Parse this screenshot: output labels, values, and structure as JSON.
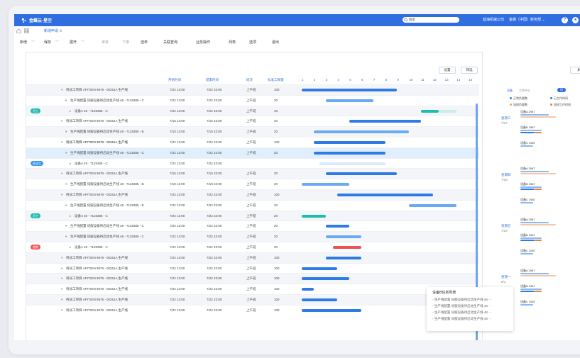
{
  "app": {
    "name": "金蝶云·星空",
    "search_placeholder": "搜索",
    "company": "蓝海机械公司",
    "org": "金蝶（中国）财务部",
    "help": "?"
  },
  "tabs": {
    "home_icon": "home-icon",
    "grid_icon": "grid-icon",
    "active_tab": "新增申请"
  },
  "menu": [
    {
      "label": "新增",
      "caret": true
    },
    {
      "label": "保存",
      "caret": true
    },
    {
      "label": "展开",
      "caret": true
    },
    {
      "label": "审核",
      "dim": true
    },
    {
      "label": "下推",
      "dim": true
    },
    {
      "label": "选单"
    },
    {
      "label": "关联查询"
    },
    {
      "label": "业务操作"
    },
    {
      "label": "列表"
    },
    {
      "label": "选项"
    },
    {
      "label": "退出"
    }
  ],
  "toolbar": {
    "settings": "设置",
    "filter": "筛选",
    "refresh": "刷新"
  },
  "columns": {
    "start": "开始时间",
    "end": "结束时间",
    "shift": "班次",
    "std_hours": "标准工数量",
    "days": [
      "1",
      "2",
      "3",
      "4",
      "5",
      "6",
      "7",
      "8",
      "9",
      "10",
      "11",
      "12",
      "13",
      "14",
      "15"
    ]
  },
  "rows": [
    {
      "indent": 1,
      "name": "待派工项目 APITION 9878 - 00251A 生产线",
      "start": "7/22 13:00",
      "end": "7/22 23:00",
      "shift": "上午班",
      "qty": "100",
      "bar": [
        0,
        8
      ],
      "color": "#2f7be6",
      "style": "alt"
    },
    {
      "indent": 2,
      "name": "生产线配置 伺服设备待启动生产线 48 - 7128385 - C",
      "start": "7/22 13:00",
      "end": "7/22 23:00",
      "shift": "上午班",
      "qty": "20",
      "bar": [
        2,
        6
      ],
      "color": "#6aaaf3"
    },
    {
      "indent": 3,
      "name": "设备A 48 - 7128385 - C",
      "start": "7/22 13:00",
      "end": "7/22 23:00",
      "shift": "上午班",
      "qty": "40",
      "bar": [
        10,
        11.5
      ],
      "color": "#1fbcb0",
      "badge": "员工",
      "badgeColor": "#1fbcb0",
      "style": "alt"
    },
    {
      "indent": 1,
      "name": "待派工项目 APITION 9878 - 00251A 生产线",
      "start": "7/16 13:00",
      "end": "7/16 23:00",
      "shift": "上午班",
      "qty": "20",
      "bar": [
        4,
        10
      ],
      "color": "#2f7be6"
    },
    {
      "indent": 2,
      "name": "生产线配置 伺服设备待启动生产线 48 - 7128385 - B",
      "start": "7/10 13:00",
      "end": "7/10 23:00",
      "shift": "上午班",
      "qty": "20",
      "bar": [
        1,
        9
      ],
      "color": "#6aaaf3",
      "style": "alt"
    },
    {
      "indent": 1,
      "name": "待派工项目 APITION 9878 - 00251A 生产线",
      "start": "7/22 13:00",
      "end": "7/22 23:00",
      "shift": "上午班",
      "qty": "100",
      "bar": [
        1,
        7
      ],
      "color": "#2f7be6",
      "bold": true
    },
    {
      "indent": 2,
      "name": "生产线配置 伺服设备待启动生产线 48 - 7128385 - C",
      "start": "7/22 13:00",
      "end": "7/22 23:00",
      "shift": "上午班",
      "qty": "20",
      "bar": [
        1,
        7
      ],
      "color": "#2f7be6",
      "style": "sel"
    },
    {
      "indent": 3,
      "name": "设备A 48 - 7128385 - C",
      "start": "7/22 13:00",
      "end": "7/22 23:00",
      "shift": "",
      "qty": "",
      "bar": [
        1.5,
        7
      ],
      "color": "#dce8fb",
      "badge": "未派工",
      "badgeColor": "#3c9bf0"
    },
    {
      "indent": 1,
      "name": "待派工项目 APITION 9878 - 00251A 生产线",
      "start": "7/16 13:00",
      "end": "7/16 23:00",
      "shift": "上午班",
      "qty": "20",
      "bar": [
        2,
        8
      ],
      "color": "#2f7be6",
      "style": "alt"
    },
    {
      "indent": 2,
      "name": "生产线配置 伺服设备待启动生产线 48 - 7128385 - B",
      "start": "7/10 13:00",
      "end": "7/10 23:00",
      "shift": "上午班",
      "qty": "20",
      "bar": [
        0,
        4
      ],
      "color": "#6aaaf3"
    },
    {
      "indent": 1,
      "name": "待派工项目 APITION 9878 - 00251A 生产线",
      "start": "7/22 13:00",
      "end": "7/22 23:00",
      "shift": "上午班",
      "qty": "100",
      "bar": [
        3,
        11
      ],
      "color": "#2f7be6",
      "style": "alt"
    },
    {
      "indent": 2,
      "name": "生产线配置 伺服设备待启动生产线 48 - 7128385 - B",
      "start": "7/22 13:00",
      "end": "7/22 23:00",
      "shift": "上午班",
      "qty": "20",
      "bar": [
        9,
        13
      ],
      "color": "#6aaaf3"
    },
    {
      "indent": 3,
      "name": "设备A 48 - 7128385 - C",
      "start": "7/22 13:00",
      "end": "7/22 23:00",
      "shift": "上午班",
      "qty": "20",
      "bar": [
        0,
        2
      ],
      "color": "#1fbcb0",
      "badge": "员工",
      "badgeColor": "#1fbcb0",
      "style": "alt"
    },
    {
      "indent": 2,
      "name": "生产线配置 伺服设备待启动生产线 48 - 7128385 - C",
      "start": "7/22 13:00",
      "end": "7/22 23:00",
      "shift": "上午班",
      "qty": "20",
      "bar": [
        2,
        4
      ],
      "color": "#2f7be6"
    },
    {
      "indent": 2,
      "name": "生产线配置 伺服设备待启动生产线 48 - 7128385 - C",
      "start": "7/22 13:00",
      "end": "7/22 23:00",
      "shift": "上午班",
      "qty": "20",
      "bar": [
        2,
        5
      ],
      "color": "#6aaaf3",
      "style": "alt"
    },
    {
      "indent": 3,
      "name": "设备A 48 - 7128385 - C",
      "start": "7/22 13:00",
      "end": "7/22 23:00",
      "shift": "上午班",
      "qty": "20",
      "bar": [
        2.6,
        5
      ],
      "color": "#ef5350",
      "badge": "超期",
      "badgeColor": "#ef5350"
    },
    {
      "indent": 1,
      "name": "待派工项目 APITION 9878 - 00251A 生产线",
      "start": "7/22 13:00",
      "end": "7/22 23:00",
      "shift": "上午班",
      "qty": "100",
      "bar": [
        2,
        5
      ],
      "color": "#2f7be6",
      "style": "alt"
    },
    {
      "indent": 1,
      "name": "待派工项目 APITION 9878 - 00251A 生产线",
      "start": "7/22 13:00",
      "end": "7/22 23:00",
      "shift": "上午班",
      "qty": "100",
      "bar": [
        0,
        3
      ],
      "color": "#2f7be6"
    },
    {
      "indent": 1,
      "name": "待派工项目 APITION 9878 - 00251A 生产线",
      "start": "7/22 13:00",
      "end": "7/22 23:00",
      "shift": "上午班",
      "qty": "100",
      "bar": [
        0,
        4
      ],
      "color": "#2f7be6",
      "style": "alt"
    },
    {
      "indent": 1,
      "name": "待派工项目 APITION 9878 - 00251A 生产线",
      "start": "7/22 13:00",
      "end": "7/22 23:00",
      "shift": "上午班",
      "qty": "100",
      "bar": [
        0,
        1
      ],
      "color": "#2f7be6"
    },
    {
      "indent": 1,
      "name": "待派工项目 APITION 9878 - 00251A 生产线",
      "start": "7/22 13:00",
      "end": "7/22 23:00",
      "shift": "上午班",
      "qty": "100",
      "bar": [
        0,
        3
      ],
      "color": "#2f7be6",
      "style": "alt"
    },
    {
      "indent": 1,
      "name": "待派工项目 APITION 9878 - 00251A 生产线",
      "start": "7/22 13:00",
      "end": "7/22 23:00",
      "shift": "上午班",
      "qty": "100",
      "bar": [
        0,
        5
      ],
      "color": "#2f7be6"
    }
  ],
  "right": {
    "tab_device": "设备",
    "tab_center": "工作中心",
    "toggle": "切",
    "legend": [
      {
        "label": "正常负载数",
        "color": "#2f7be6"
      },
      {
        "label": "已工作时间",
        "color": "#2f7be6"
      },
      {
        "label": "加班负载数",
        "color": "#f0a060"
      },
      {
        "label": "加班工作时间",
        "color": "#f08030"
      }
    ],
    "weeks": [
      {
        "label": "星期三",
        "date": "7/27"
      },
      {
        "label": "星期四",
        "date": "7/28"
      },
      {
        "label": "星期五",
        "date": "7/29"
      },
      {
        "label": "星期一",
        "date": "8/1"
      }
    ],
    "equip": [
      "设备A 2987",
      "设备B 2987",
      "设备C 2987"
    ]
  },
  "popup": {
    "title": "设备B任务列表",
    "items": [
      "生产线配置 伺服设备待启动生产线 48 ···",
      "生产线配置 伺服设备待启动生产线 48 ···",
      "生产线配置 伺服设备待启动生产线 48 ···",
      "生产线配置 伺服设备待启动生产线 48 ···"
    ]
  }
}
